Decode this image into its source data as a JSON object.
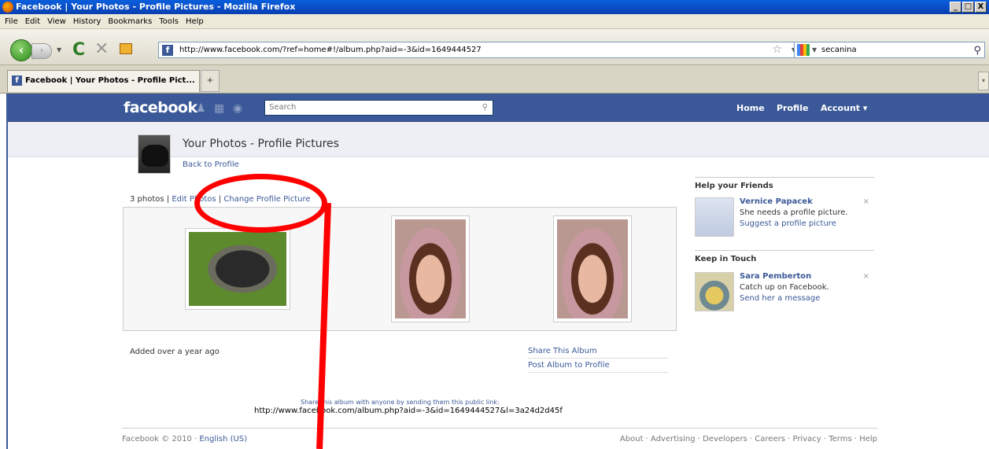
{
  "window": {
    "title": "Facebook | Your Photos - Profile Pictures - Mozilla Firefox",
    "btn_min": "_",
    "btn_max": "□",
    "btn_close": "X"
  },
  "menu": {
    "items": [
      "File",
      "Edit",
      "View",
      "History",
      "Bookmarks",
      "Tools",
      "Help"
    ]
  },
  "nav": {
    "url": "http://www.facebook.com/?ref=home#!/album.php?aid=-3&id=1649444527",
    "search_value": "secanina"
  },
  "tab": {
    "label": "Facebook | Your Photos - Profile Pict...",
    "new_tab": "+"
  },
  "fb": {
    "logo": "facebook",
    "search_placeholder": "Search",
    "nav_home": "Home",
    "nav_profile": "Profile",
    "nav_account": "Account ▾"
  },
  "album": {
    "title": "Your Photos - Profile Pictures",
    "back_link": "Back to Profile",
    "count": "3 photos",
    "sep": "|",
    "edit_photos": "Edit Photos",
    "change_picture": "Change Profile Picture",
    "added": "Added over a year ago",
    "share_album": "Share This Album",
    "post_album": "Post Album to Profile",
    "share_note": "Share this album with anyone by sending them this public link:",
    "share_url": "http://www.facebook.com/album.php?aid=-3&id=1649444527&l=3a24d2d45f"
  },
  "sidebar": {
    "help_title": "Help your Friends",
    "friend1_name": "Vernice Papacek",
    "friend1_text": "She needs a profile picture.",
    "friend1_link": "Suggest a profile picture",
    "keep_title": "Keep in Touch",
    "friend2_name": "Sara Pemberton",
    "friend2_text": "Catch up on Facebook.",
    "friend2_link": "Send her a message",
    "close": "×"
  },
  "footer": {
    "copyright": "Facebook © 2010 · ",
    "language": "English (US)",
    "links": "About · Advertising · Developers · Careers · Privacy · Terms · Help"
  }
}
